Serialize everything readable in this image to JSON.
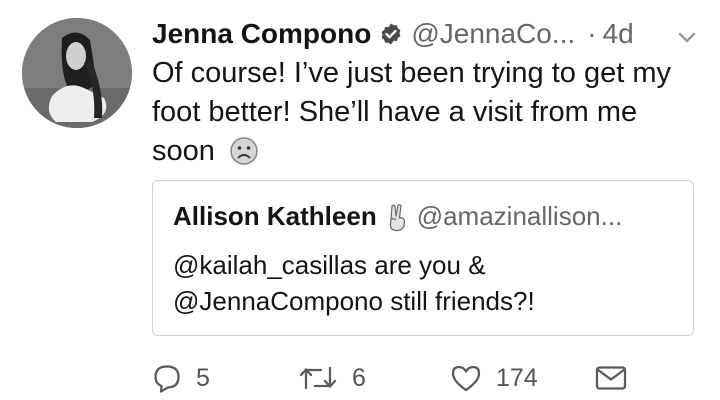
{
  "tweet": {
    "author_name": "Jenna Compono",
    "handle": "@JennaCo...",
    "separator": "·",
    "time": "4d",
    "text": "Of course! I’ve just been trying to get my foot better! She’ll have a visit from me soon",
    "emoji_icon": "frowning-face-emoji"
  },
  "quoted": {
    "author_name": "Allison Kathleen",
    "emoji_icon": "victory-hand-emoji",
    "handle": "@amazinallison...",
    "text_line1": "@kailah_casillas are you &",
    "text_line2": "@JennaCompono still friends?!"
  },
  "actions": {
    "reply_count": "5",
    "retweet_count": "6",
    "like_count": "174"
  },
  "icons": [
    "verified-icon",
    "chevron-down-icon",
    "reply-icon",
    "retweet-icon",
    "like-icon",
    "message-icon"
  ]
}
